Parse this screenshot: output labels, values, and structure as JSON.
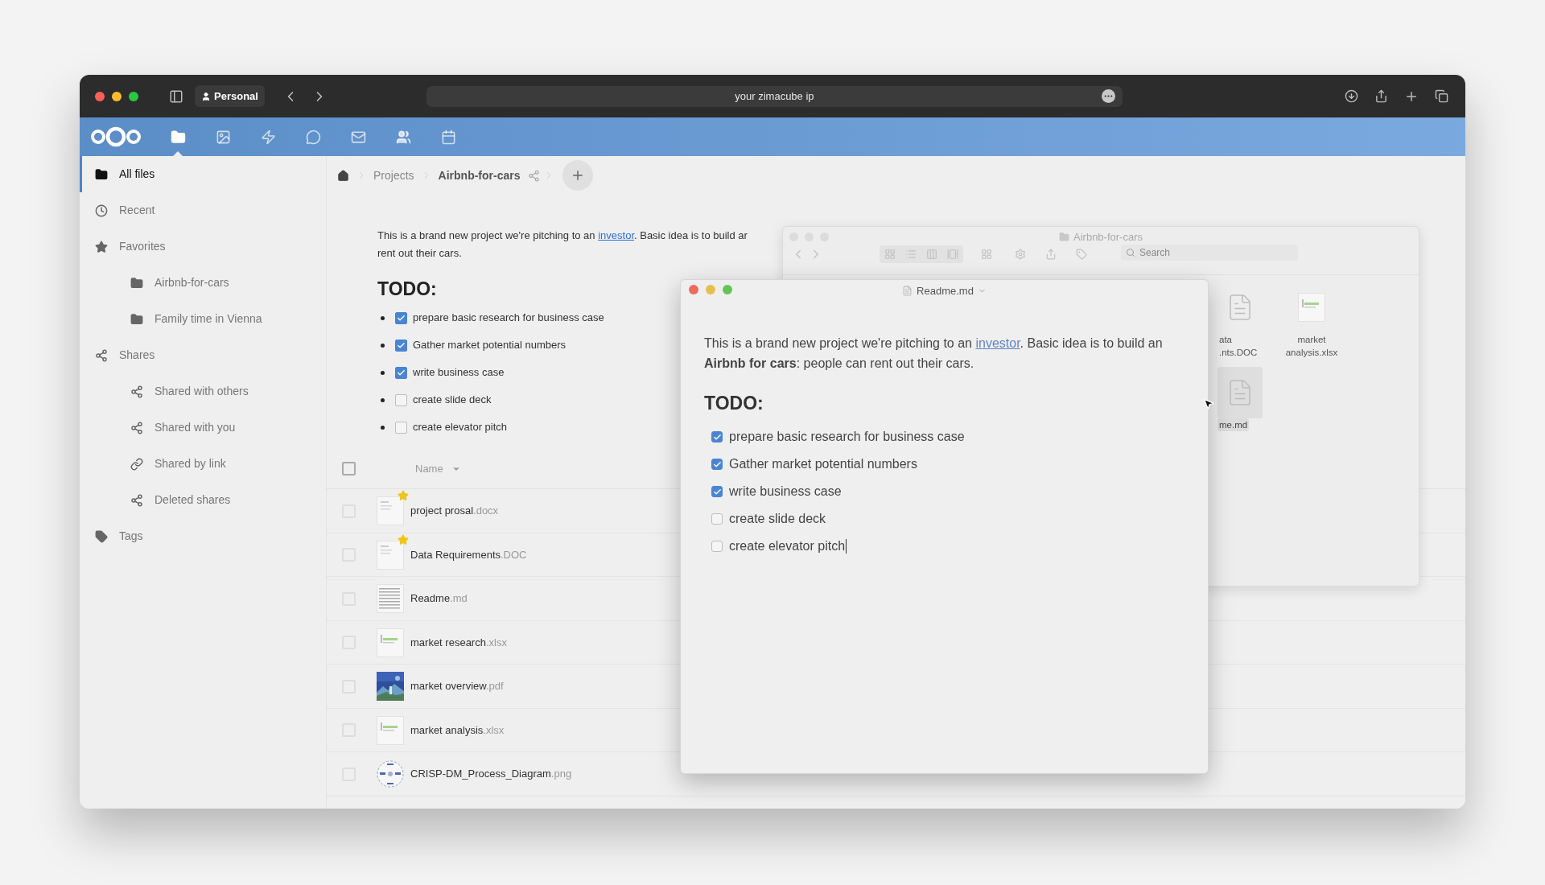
{
  "browser": {
    "profile": "Personal",
    "address": "your zimacube ip"
  },
  "app_nav": [
    {
      "kind": "files",
      "selected": true
    },
    {
      "kind": "photos",
      "selected": false
    },
    {
      "kind": "activity",
      "selected": false
    },
    {
      "kind": "talk",
      "selected": false
    },
    {
      "kind": "mail",
      "selected": false
    },
    {
      "kind": "contacts",
      "selected": false
    },
    {
      "kind": "calendar",
      "selected": false
    }
  ],
  "sidebar": {
    "items": [
      {
        "label": "All files",
        "kind": "folder",
        "selected": true
      },
      {
        "label": "Recent",
        "kind": "clock",
        "selected": false
      },
      {
        "label": "Favorites",
        "kind": "star",
        "selected": false,
        "children": [
          {
            "label": "Airbnb-for-cars",
            "kind": "folder",
            "selected": false
          },
          {
            "label": "Family time in Vienna",
            "kind": "folder",
            "selected": false
          }
        ]
      },
      {
        "label": "Shares",
        "kind": "share",
        "selected": false,
        "children": [
          {
            "label": "Shared with others",
            "kind": "share",
            "selected": false
          },
          {
            "label": "Shared with you",
            "kind": "share",
            "selected": false
          },
          {
            "label": "Shared by link",
            "kind": "link",
            "selected": false
          },
          {
            "label": "Deleted shares",
            "kind": "deleted-share",
            "selected": false
          }
        ]
      },
      {
        "label": "Tags",
        "kind": "tag",
        "selected": false
      }
    ]
  },
  "breadcrumb": {
    "items": [
      "Projects",
      "Airbnb-for-cars"
    ]
  },
  "preview": {
    "line_1_before": "This is a brand new project we're pitching to an ",
    "line_1_link": "investor",
    "line_1_after": ". Basic idea is to build ar",
    "line_2": "rent out their cars.",
    "heading": "TODO:",
    "todos": [
      {
        "label": "prepare basic research for business case",
        "checked": true
      },
      {
        "label": "Gather market potential numbers",
        "checked": true
      },
      {
        "label": "write business case",
        "checked": true
      },
      {
        "label": "create slide deck",
        "checked": false
      },
      {
        "label": "create elevator pitch",
        "checked": false
      }
    ]
  },
  "files": {
    "column": "Name",
    "all_selected": false,
    "rows": [
      {
        "name": "project prosal",
        "extension": ".docx",
        "favorite": true,
        "kind": "doc",
        "selected": false
      },
      {
        "name": "Data Requirements",
        "extension": ".DOC",
        "favorite": true,
        "kind": "doc",
        "selected": false
      },
      {
        "name": "Readme",
        "extension": ".md",
        "favorite": false,
        "kind": "text",
        "selected": false
      },
      {
        "name": "market research",
        "extension": ".xlsx",
        "favorite": false,
        "kind": "sheet",
        "selected": false
      },
      {
        "name": "market overview",
        "extension": ".pdf",
        "favorite": false,
        "kind": "picture",
        "selected": false
      },
      {
        "name": "market analysis",
        "extension": ".xlsx",
        "favorite": false,
        "kind": "sheet",
        "selected": false
      },
      {
        "name": "CRISP-DM_Process_Diagram",
        "extension": ".png",
        "favorite": false,
        "kind": "diagram",
        "selected": false
      }
    ]
  },
  "finder_window": {
    "title": "Airbnb-for-cars",
    "search_placeholder": "Search",
    "items": [
      {
        "name_lines": [
          "ata",
          ".nts.DOC"
        ],
        "kind": "doc",
        "selected": false
      },
      {
        "name_lines": [
          "market",
          "analysis.xlsx"
        ],
        "kind": "sheet",
        "selected": false
      },
      {
        "name_lines": [
          "me.md"
        ],
        "kind": "text",
        "selected": true
      }
    ]
  },
  "editor_window": {
    "title": "Readme.md",
    "text_before": "This is a brand new project we're pitching to an ",
    "link": "investor",
    "text_after": ". Basic idea is to build an **Airbnb for cars**: people can rent out their cars.",
    "heading": "TODO:",
    "todos": [
      {
        "label": "prepare basic research for business case",
        "checked": true
      },
      {
        "label": "Gather market potential numbers",
        "checked": true
      },
      {
        "label": "write business case",
        "checked": true
      },
      {
        "label": "create slide deck",
        "checked": false
      },
      {
        "label": "create elevator pitch",
        "checked": false
      }
    ]
  }
}
